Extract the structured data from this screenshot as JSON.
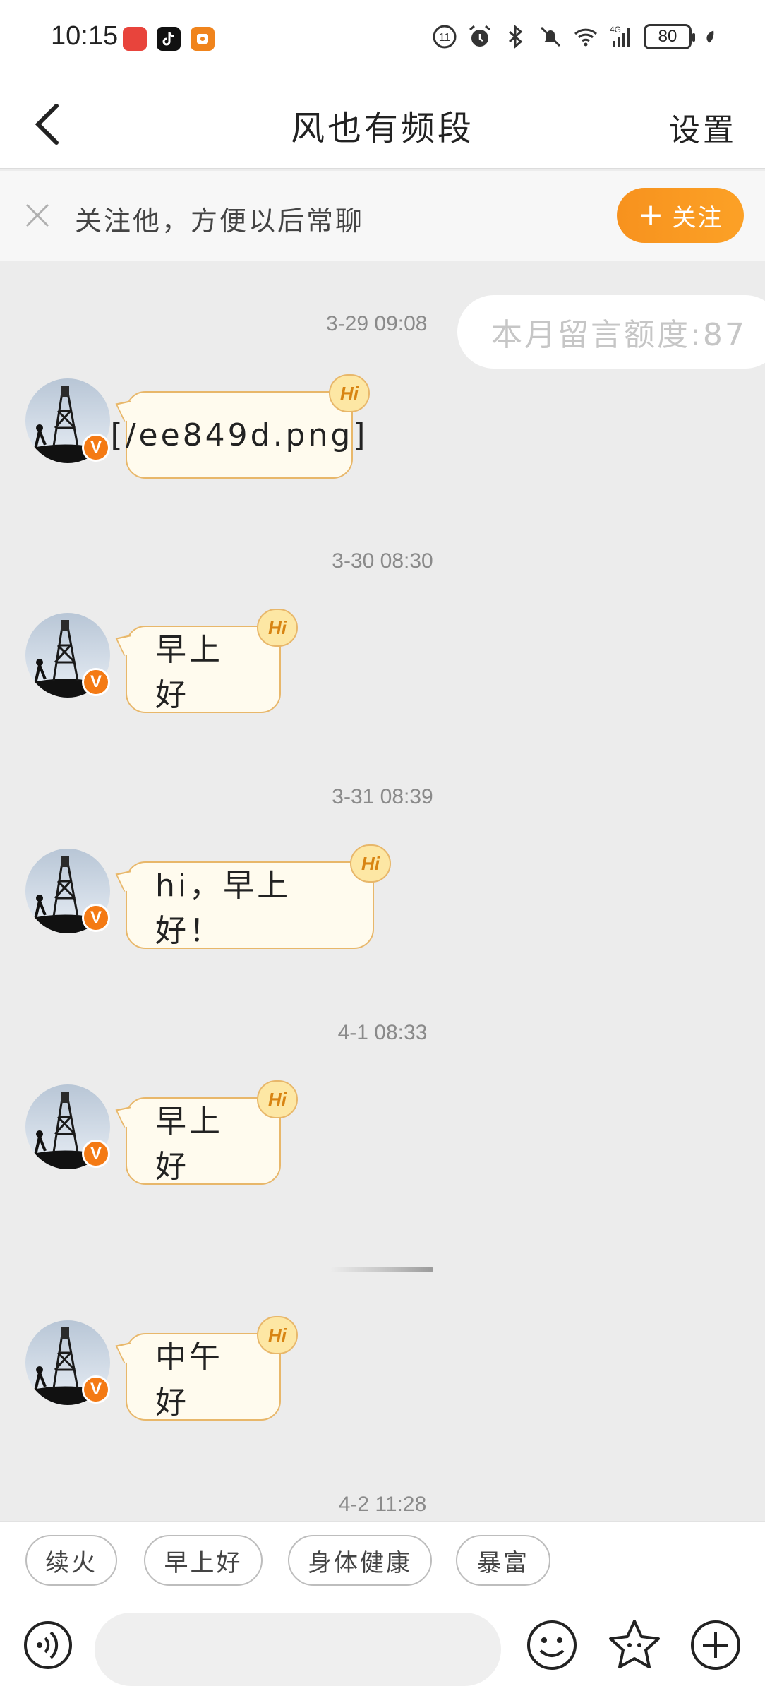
{
  "status": {
    "time": "10:15",
    "battery": "80",
    "network": "4G",
    "wifi_sup": "6"
  },
  "header": {
    "title": "风也有频段",
    "settings_label": "设置"
  },
  "follow_banner": {
    "text": "关注他，方便以后常聊",
    "button_label": "关注",
    "button_plus": "+"
  },
  "quota": {
    "timestamp": "3-29 09:08",
    "text": "本月留言额度:87"
  },
  "messages": [
    {
      "text": "[/ee849d.png]",
      "hi": "Hi"
    },
    {
      "timestamp": "3-30 08:30",
      "text": "早上好",
      "hi": "Hi"
    },
    {
      "timestamp": "3-31 08:39",
      "text": "hi，早上好！",
      "hi": "Hi"
    },
    {
      "timestamp": "4-1 08:33",
      "text": "早上好",
      "hi": "Hi"
    },
    {
      "text": "中午好",
      "hi": "Hi"
    }
  ],
  "last_timestamp": "4-2 11:28",
  "avatar_badge": "V",
  "quick_replies": [
    "续火",
    "早上好",
    "身体健康",
    "暴富"
  ],
  "colors": {
    "accent": "#f7921e",
    "bubble_border": "#e8b76a",
    "bubble_bg": "#fffbee",
    "chat_bg": "#ececec",
    "verified_badge": "#f47a14"
  }
}
